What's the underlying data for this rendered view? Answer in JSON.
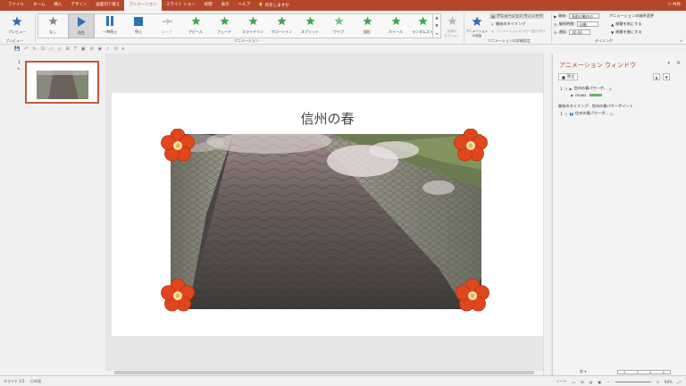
{
  "tabs": [
    "ファイル",
    "ホーム",
    "挿入",
    "デザイン",
    "画面切り替え",
    "アニメーション",
    "スライド ショー",
    "校閲",
    "表示",
    "ヘルプ"
  ],
  "active_tab": "アニメーション",
  "tell_me": "何をしますか",
  "share": "共有",
  "ribbon": {
    "preview_label": "プレビュー",
    "preview_group": "プレビュー",
    "animations": [
      "なし",
      "再生",
      "一時停止",
      "停止",
      "シーク",
      "アピール",
      "フェード",
      "スライドイン",
      "フロートイン",
      "スプリット",
      "ワイプ",
      "図形",
      "ホイール",
      "ランダムスト"
    ],
    "effect_options": "効果の\nオプション",
    "animation_group": "アニメーション",
    "add_animation": "アニメーション\nの追加",
    "anim_pane_btn": "アニメーション ウィンドウ",
    "trigger_btn": "開始のタイミング",
    "painter_btn": "アニメーションのコピー/貼り付け",
    "adv_group": "アニメーションの詳細設定",
    "start_label": "開始:",
    "start_value": "直前の動作の...",
    "duration_label": "継続時間:",
    "duration_value": "自動",
    "delay_label": "遅延:",
    "delay_value": "00.00",
    "reorder_label": "アニメーションの順序変更",
    "move_earlier": "順番を前にする",
    "move_later": "順番を後にする",
    "timing_group": "タイミング"
  },
  "thumbnail": {
    "number": "1",
    "star": "★"
  },
  "slide": {
    "title": "信州の春"
  },
  "anim_pane": {
    "title": "アニメーション ウィンドウ",
    "play_label": "停止",
    "items": [
      {
        "num": "1",
        "label": "信州の春パワーポ..."
      },
      {
        "num": "",
        "label": "mvws"
      }
    ],
    "trigger_heading": "開始のタイミング：信州の春パワーポイント",
    "trigger_item": {
      "num": "1",
      "label": "信州の春パワーポ..."
    },
    "seconds_label": "秒",
    "timeline_ticks": [
      "0",
      "2",
      "4",
      "6"
    ]
  },
  "status": {
    "slide": "スライド 1/1",
    "lang": "日本語",
    "notes": "ノート",
    "zoom": "68%"
  },
  "colors": {
    "accent": "#b7472a",
    "green": "#3fa74f",
    "blue": "#2e6fb5"
  }
}
